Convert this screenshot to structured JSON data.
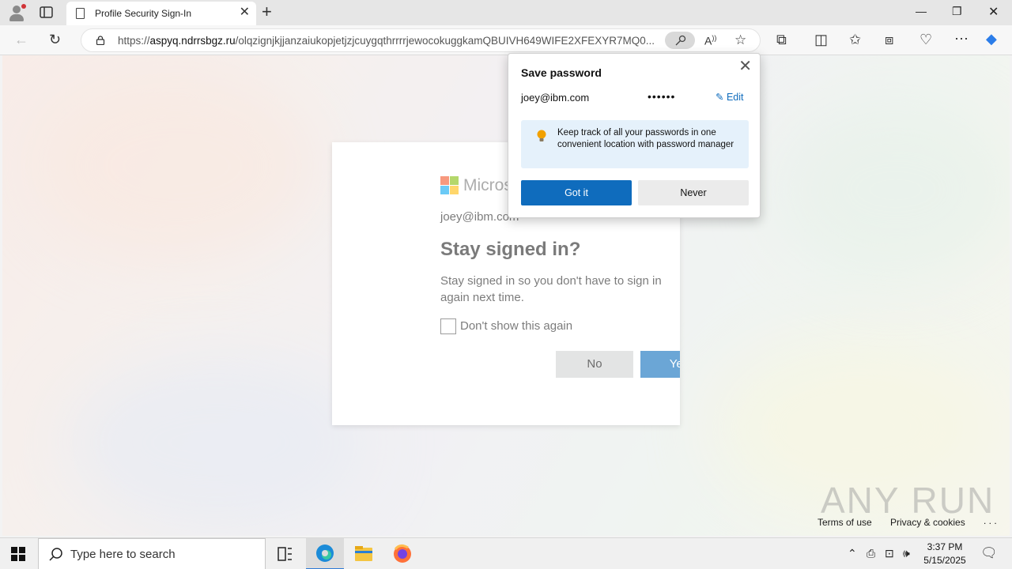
{
  "browser": {
    "tab_title": "Profile Security Sign-In",
    "url_domain": "aspyq.ndrrsbgz.ru",
    "url_prefix": "https://",
    "url_path": "/olqzignjkjjanzaiukopjetjzjcuygqthrrrrjewocokuggkamQBUIVH649WIFE2XFEXYR7MQ0..."
  },
  "save_password": {
    "title": "Save password",
    "username": "joey@ibm.com",
    "password_mask": "••••••",
    "edit_label": "Edit",
    "tip": "Keep track of all your passwords in one convenient location with password manager",
    "got_it_label": "Got it",
    "never_label": "Never"
  },
  "signin": {
    "brand": "Microsoft",
    "email": "joey@ibm.com",
    "heading": "Stay signed in?",
    "description": "Stay signed in so you don't have to sign in again next time.",
    "checkbox_label": "Don't show this again",
    "no_label": "No",
    "yes_label": "Yes",
    "brand_colors": [
      "#f25022",
      "#7fba00",
      "#00a4ef",
      "#ffb900"
    ]
  },
  "footer": {
    "terms": "Terms of use",
    "privacy": "Privacy & cookies",
    "more": ". . ."
  },
  "watermark": "ANY RUN",
  "taskbar": {
    "search_placeholder": "Type here to search",
    "time": "3:37 PM",
    "date": "5/15/2025"
  }
}
